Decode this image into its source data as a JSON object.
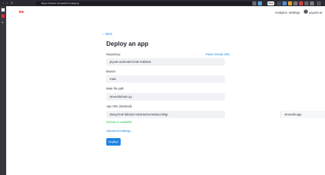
{
  "browser": {
    "url": "https://share.streamlit.io/deploy",
    "new_badge": "New"
  },
  "header": {
    "links": [
      "Analytics",
      "Settings"
    ],
    "username": "piyush-an"
  },
  "form": {
    "back_label": "Back",
    "title": "Deploy an app",
    "repository": {
      "label": "Repository",
      "link": "Paste GitHub URL",
      "value": "piyush-an/DAMG7245-Fall2023"
    },
    "branch": {
      "label": "Branch",
      "value": "main"
    },
    "main_file": {
      "label": "Main file path",
      "value": "streamlit/main.py"
    },
    "app_url": {
      "label": "App URL (Optional)",
      "value": "damg7245-fall2023-4fvdn5ehmm9dsezcbhjp",
      "suffix": "streamlit.app",
      "status": "Domain is available"
    },
    "advanced_label": "Advanced settings...",
    "deploy_label": "Deploy!"
  },
  "colors": {
    "accent": "#1c83e1",
    "success": "#21c354",
    "input_bg": "#f0f2f6"
  }
}
